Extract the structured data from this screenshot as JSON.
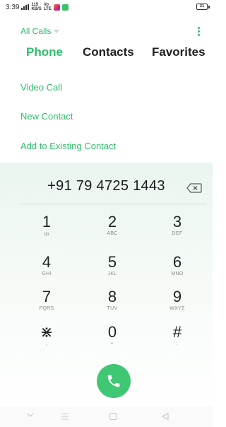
{
  "status_bar": {
    "time": "3:39",
    "network_label_top": "115",
    "network_label_bottom": "KB/S",
    "lte_label_top": "Vo",
    "lte_label_bottom": "LTE",
    "battery": "31"
  },
  "header": {
    "filter_label": "All Calls",
    "menu_icon": "more-vert-icon"
  },
  "tabs": [
    {
      "label": "Phone",
      "active": true
    },
    {
      "label": "Contacts",
      "active": false
    },
    {
      "label": "Favorites",
      "active": false
    }
  ],
  "options": [
    {
      "label": "Video Call"
    },
    {
      "label": "New Contact"
    },
    {
      "label": "Add to Existing Contact"
    }
  ],
  "dialer": {
    "number": "+91 79 4725 1443",
    "keys": [
      {
        "digit": "1",
        "sub": "ꝏ"
      },
      {
        "digit": "2",
        "sub": "ABC"
      },
      {
        "digit": "3",
        "sub": "DEF"
      },
      {
        "digit": "4",
        "sub": "GHI"
      },
      {
        "digit": "5",
        "sub": "JKL"
      },
      {
        "digit": "6",
        "sub": "MNO"
      },
      {
        "digit": "7",
        "sub": "PQRS"
      },
      {
        "digit": "8",
        "sub": "TUV"
      },
      {
        "digit": "9",
        "sub": "WXYZ"
      },
      {
        "digit": "⋇",
        "sub": ","
      },
      {
        "digit": "0",
        "sub": "+"
      },
      {
        "digit": "#",
        "sub": ";"
      }
    ]
  },
  "colors": {
    "accent": "#2ebd6b",
    "call_button": "#3fc774"
  }
}
